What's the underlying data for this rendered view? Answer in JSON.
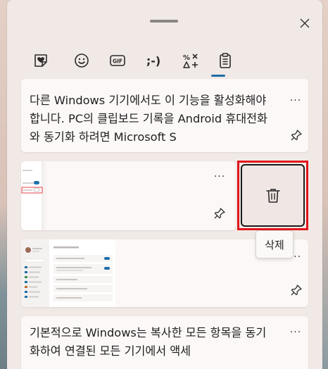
{
  "tabs": [
    {
      "name": "stickers",
      "icon": "heart-sticker-icon"
    },
    {
      "name": "emoji",
      "icon": "smiley-icon"
    },
    {
      "name": "gif",
      "label": "GIF",
      "icon": "gif-icon"
    },
    {
      "name": "kaomoji",
      "label": ";-)",
      "icon": "kaomoji-icon"
    },
    {
      "name": "symbols",
      "label": "%     ",
      "icon": "symbols-icon"
    },
    {
      "name": "clipboard",
      "icon": "clipboard-icon",
      "active": true
    }
  ],
  "clipboard": {
    "items": [
      {
        "type": "text",
        "text": "다른 Windows 기기에서도 이 기능을 활성화해야 합니다. PC의 클립보드 기록을 Android 휴대전화와 동기화 하려면 Microsoft S"
      },
      {
        "type": "image"
      },
      {
        "type": "image"
      },
      {
        "type": "text",
        "text": "기본적으로 Windows는 복사한 모든 항목을 동기화하여 연결된 모든 기기에서 액세"
      }
    ],
    "more_label": "···"
  },
  "delete": {
    "tooltip": "삭제"
  },
  "colors": {
    "accent": "#1e6fa8",
    "highlight": "#e0161c"
  }
}
